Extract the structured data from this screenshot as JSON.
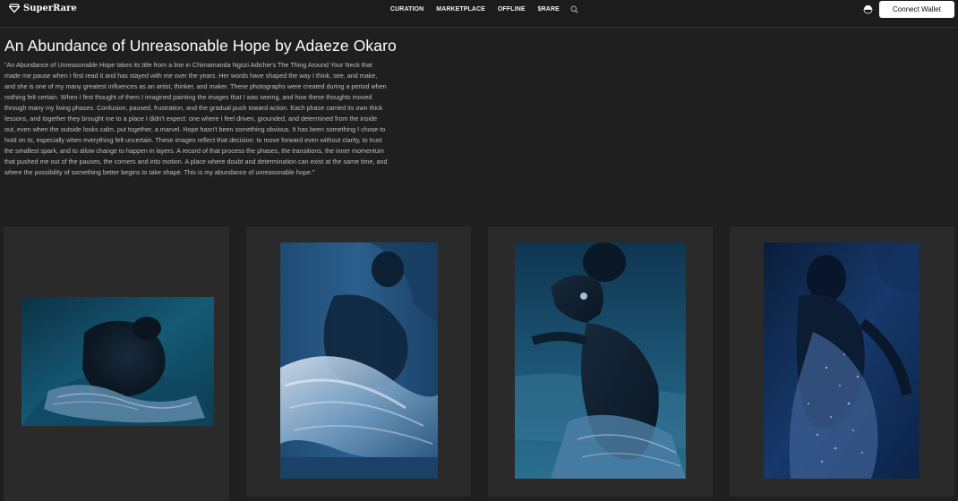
{
  "navbar": {
    "logo_text": "SuperRare",
    "links": [
      "CURATION",
      "MARKETPLACE",
      "OFFLINE",
      "$RARE"
    ],
    "connect_wallet_label": "Connect Wallet"
  },
  "exhibition": {
    "title": "An Abundance of Unreasonable Hope by Adaeze Okaro",
    "description": "\"An Abundance of Unreasonable Hope takes its title from a line in Chimamanda Ngozi Adichie's The Thing Around Your Neck that made me pause when I first read it and has stayed with me over the years. Her words have shaped the way I think, see, and make, and she is one of my many greatest influences as an artist, thinker, and maker. These photographs were created during a period when nothing felt certain. When I first thought of them I imagined painting the images that I was seeing, and how these thoughts moved through many my living phases. Confusion, paused, frustration, and the gradual push toward action. Each phase carried its own thick lessons, and together they brought me to a place I didn't expect: one where I feel driven, grounded, and determined from the inside out, even when the outside looks calm, put together, a marvel. Hope hasn't been something obvious. It has been something I chose to hold on to, especially when everything felt uncertain. These images reflect that decision: to move forward even without clarity, to trust the smallest spark, and to allow change to happen in layers. A record of that process the phases, the transitions, the inner momentum that pushed me out of the pauses, the corners and into motion. A place where doubt and determination can exist at the same time, and where the possibility of something better begins to take shape. This is my abundance of unreasonable hope.\""
  },
  "artworks": [
    {
      "subject": "figure reclining on fabric",
      "palette": [
        "#0f3b52",
        "#1b5570",
        "#7fa6c4"
      ]
    },
    {
      "subject": "motion-blurred figure in dress",
      "palette": [
        "#112e4a",
        "#3d6c96",
        "#c7d8e8"
      ]
    },
    {
      "subject": "figure in profile with earring",
      "palette": [
        "#0e3550",
        "#1f5a7a",
        "#6f98b8"
      ]
    },
    {
      "subject": "figure in sequined gown",
      "palette": [
        "#0a2140",
        "#1a3f6a",
        "#8fa8cc"
      ]
    }
  ],
  "colors": {
    "background": "#1f1f1f",
    "card": "#2a2a2a",
    "button": "#ffffff"
  }
}
